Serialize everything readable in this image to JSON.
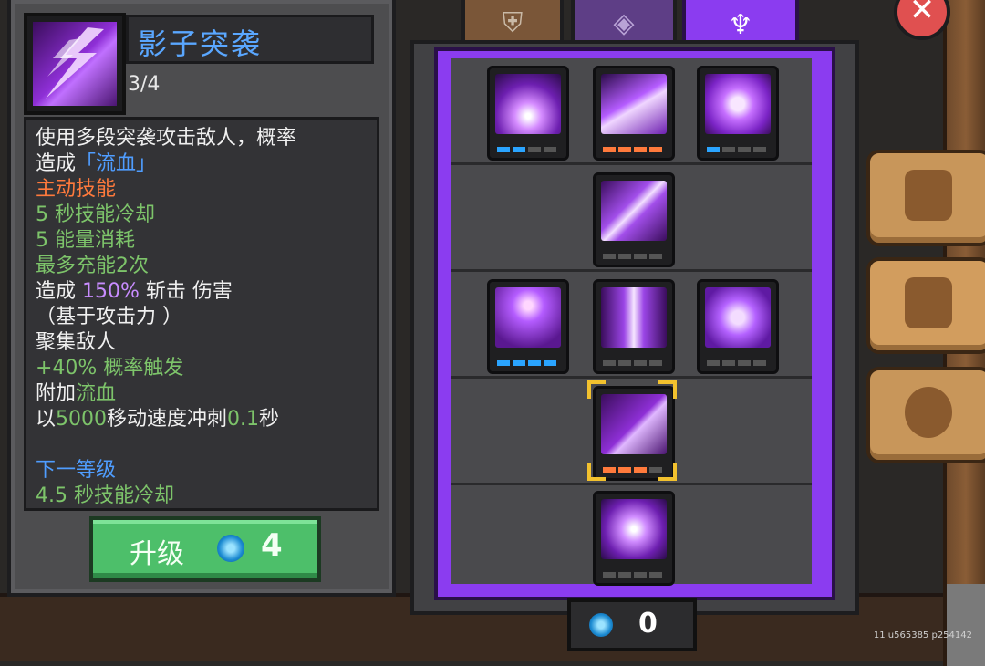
{
  "skill": {
    "name": "影子突袭",
    "level": "3/4"
  },
  "description": {
    "line1": "使用多段突袭攻击敌人，概率",
    "line2_prefix": "造成",
    "line2_highlight": "「流血」",
    "line3": "主动技能",
    "line4": "5 秒技能冷却",
    "line5": "5 能量消耗",
    "line6": "最多充能2次",
    "line7_prefix": "造成 ",
    "line7_value": "150%",
    "line7_suffix": " 斩击 伤害",
    "line8": "（基于攻击力 ）",
    "line9": "聚集敌人",
    "line10": "+40% 概率触发",
    "line11_prefix": "附加",
    "line11_highlight": "流血",
    "line12_prefix": "以",
    "line12_speed": "5000",
    "line12_mid": "移动速度冲刺",
    "line12_time": "0.1",
    "line12_suffix": "秒",
    "next_label": "下一等级",
    "next_line": "4.5 秒技能冷却"
  },
  "upgrade": {
    "label": "升级",
    "cost": "4",
    "icon": "swirl-crystal-icon"
  },
  "tabs": [
    {
      "name": "tab-equipment",
      "icon": "shield-icon"
    },
    {
      "name": "tab-diamond",
      "icon": "diamond-icon"
    },
    {
      "name": "tab-skill-tree",
      "icon": "crest-icon",
      "active": true
    }
  ],
  "side_buttons": [
    {
      "name": "helmet",
      "icon": "helmet-icon"
    },
    {
      "name": "skills",
      "icon": "swords-icon",
      "active": true
    },
    {
      "name": "settings",
      "icon": "gear-icon"
    }
  ],
  "currency": {
    "value": "0",
    "icon": "swirl-crystal-icon"
  },
  "close": {
    "icon": "close-icon",
    "glyph": "✕"
  },
  "watermark": "11 u565385 p254142",
  "colors": {
    "accent_purple": "#8b3cf0",
    "title_blue": "#5aa7ff",
    "active_orange": "#ff7a3c",
    "stat_green": "#7dc46a",
    "upgrade_green": "#4dbf6a"
  }
}
